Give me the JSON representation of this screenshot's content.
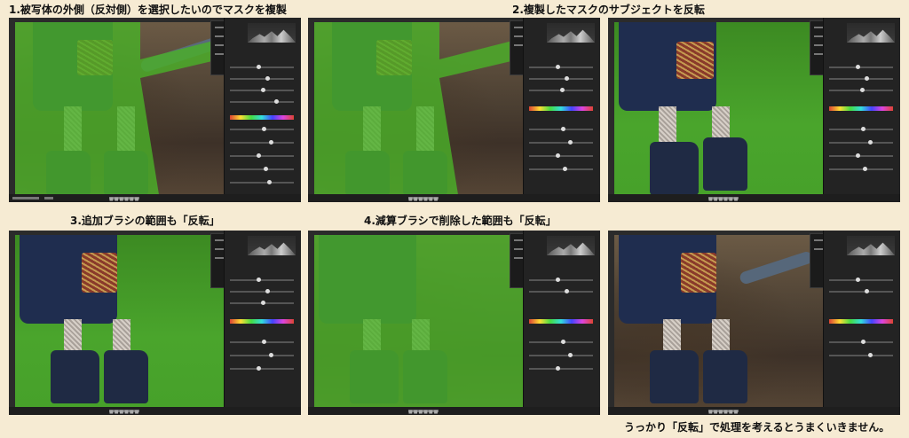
{
  "captions": {
    "step1": "1.被写体の外側（反対側）を選択したいのでマスクを複製",
    "step2": "2.複製したマスクのサブジェクトを反転",
    "step3": "3.追加ブラシの範囲も「反転」",
    "step4": "4.減算ブラシで削除した範囲も「反転」",
    "conclusion": "うっかり「反転」で処理を考えるとうまくいきません。"
  },
  "screens": [
    {
      "id": "s1",
      "state": "subject-masked",
      "menu_open": true
    },
    {
      "id": "s2",
      "state": "subject-masked",
      "menu_open": true
    },
    {
      "id": "s3",
      "state": "background-masked",
      "menu_open": false
    },
    {
      "id": "s4",
      "state": "background-masked",
      "menu_open": true
    },
    {
      "id": "s5",
      "state": "subject-masked",
      "menu_open": true
    },
    {
      "id": "s6",
      "state": "outline-only",
      "menu_open": false
    }
  ],
  "colors": {
    "background": "#f6ebd3",
    "mask_overlay": "#4ab028",
    "panel": "#232323",
    "menu_selection": "#2f6fd6"
  }
}
